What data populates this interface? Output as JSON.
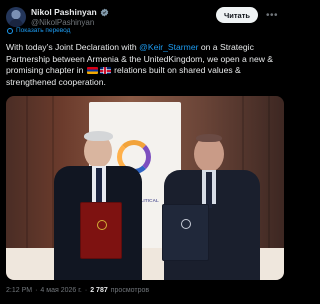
{
  "header": {
    "display_name": "Nikol Pashinyan",
    "handle": "@NikolPashinyan",
    "read_button": "Читать",
    "more_icon": "more-horizontal-icon"
  },
  "translate": {
    "label": "Показать перевод"
  },
  "tweet": {
    "segments": [
      "With today’s Joint Declaration with ",
      "@Keir_Starmer",
      " on a Strategic Partnership between Armenia & the UnitedKingdom, we open a new & promising chapter in ",
      " relations built on shared values & strengthened cooperation."
    ]
  },
  "media": {
    "banner_text": "EUROPEAN POLITICAL COMMUNITY"
  },
  "footer": {
    "time": "2:12 PM",
    "separator": "·",
    "date": "4 мая 2026 г.",
    "views_count": "2 787",
    "views_label": "просмотров"
  },
  "colors": {
    "accent": "#1d9bf0",
    "background": "#000000",
    "text": "#e7e9ea",
    "muted": "#71767b"
  }
}
